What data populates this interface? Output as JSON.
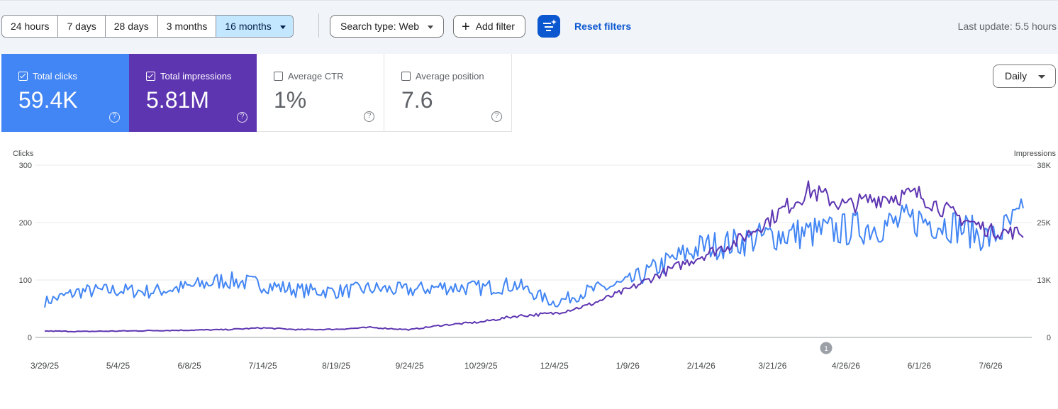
{
  "toolbar": {
    "ranges": [
      "24 hours",
      "7 days",
      "28 days",
      "3 months",
      "16 months"
    ],
    "search_type": "Search type: Web",
    "add_filter": "Add filter",
    "reset_filters": "Reset filters",
    "last_update": "Last update: 5.5 hours"
  },
  "cards": {
    "clicks": {
      "label": "Total clicks",
      "value": "59.4K",
      "checked": true,
      "color": "#4285f4"
    },
    "impressions": {
      "label": "Total impressions",
      "value": "5.81M",
      "checked": true,
      "color": "#5e35b1"
    },
    "ctr": {
      "label": "Average CTR",
      "value": "1%",
      "checked": false
    },
    "position": {
      "label": "Average position",
      "value": "7.6",
      "checked": false
    }
  },
  "granularity": "Daily",
  "chart_data": {
    "type": "line",
    "left_axis": {
      "label": "Clicks",
      "ticks": [
        "0",
        "100",
        "200",
        "300"
      ],
      "range": [
        0,
        300
      ]
    },
    "right_axis": {
      "label": "Impressions",
      "ticks": [
        "0",
        "13K",
        "25K",
        "38K"
      ],
      "range": [
        0,
        38000
      ]
    },
    "x_ticks": [
      "3/29/25",
      "5/4/25",
      "6/8/25",
      "7/14/25",
      "8/19/25",
      "9/24/25",
      "10/29/25",
      "12/4/25",
      "1/9/26",
      "2/14/26",
      "3/21/26",
      "4/26/26",
      "6/1/26",
      "7/6/26"
    ],
    "annotation": "1",
    "series": [
      {
        "name": "Clicks",
        "axis": "left",
        "color": "#4285f4",
        "points": [
          [
            "3/29/25",
            62
          ],
          [
            "4/15/25",
            80
          ],
          [
            "5/4/25",
            82
          ],
          [
            "5/20/25",
            80
          ],
          [
            "6/8/25",
            88
          ],
          [
            "6/25/25",
            100
          ],
          [
            "7/14/25",
            92
          ],
          [
            "8/1/25",
            82
          ],
          [
            "8/19/25",
            80
          ],
          [
            "9/5/25",
            85
          ],
          [
            "9/24/25",
            82
          ],
          [
            "10/10/25",
            88
          ],
          [
            "10/29/25",
            86
          ],
          [
            "11/15/25",
            92
          ],
          [
            "12/4/25",
            60
          ],
          [
            "12/20/25",
            80
          ],
          [
            "1/9/26",
            95
          ],
          [
            "1/25/26",
            125
          ],
          [
            "2/14/26",
            158
          ],
          [
            "3/3/26",
            165
          ],
          [
            "3/21/26",
            178
          ],
          [
            "4/8/26",
            182
          ],
          [
            "4/26/26",
            188
          ],
          [
            "5/14/26",
            195
          ],
          [
            "6/1/26",
            205
          ],
          [
            "6/18/26",
            195
          ],
          [
            "7/6/26",
            172
          ],
          [
            "7/22/26",
            212
          ]
        ]
      },
      {
        "name": "Impressions",
        "axis": "right",
        "color": "#5e35b1",
        "points": [
          [
            "3/29/25",
            1400
          ],
          [
            "4/15/25",
            1300
          ],
          [
            "5/4/25",
            1400
          ],
          [
            "5/20/25",
            1500
          ],
          [
            "6/8/25",
            1600
          ],
          [
            "6/25/25",
            1700
          ],
          [
            "7/14/25",
            2100
          ],
          [
            "8/1/25",
            1700
          ],
          [
            "8/19/25",
            1800
          ],
          [
            "9/5/25",
            2200
          ],
          [
            "9/24/25",
            1700
          ],
          [
            "10/10/25",
            2700
          ],
          [
            "10/29/25",
            3400
          ],
          [
            "11/15/25",
            4700
          ],
          [
            "12/4/25",
            5300
          ],
          [
            "12/20/25",
            7000
          ],
          [
            "1/9/26",
            10500
          ],
          [
            "1/25/26",
            14000
          ],
          [
            "2/14/26",
            18000
          ],
          [
            "3/3/26",
            21000
          ],
          [
            "3/21/26",
            26500
          ],
          [
            "4/8/26",
            32500
          ],
          [
            "4/26/26",
            29000
          ],
          [
            "5/14/26",
            31000
          ],
          [
            "6/1/26",
            31500
          ],
          [
            "6/18/26",
            27000
          ],
          [
            "7/6/26",
            23500
          ],
          [
            "7/22/26",
            23000
          ]
        ]
      }
    ]
  }
}
